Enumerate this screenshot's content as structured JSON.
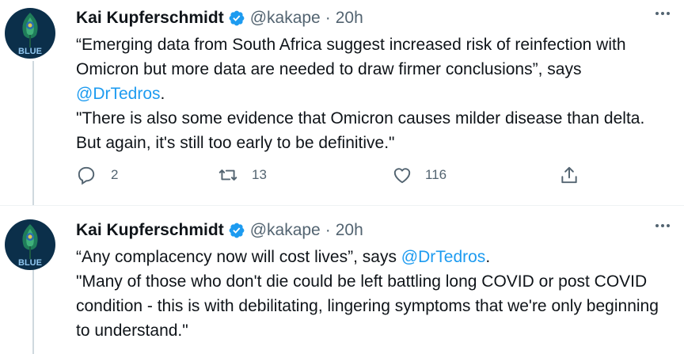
{
  "tweets": [
    {
      "name": "Kai Kupferschmidt",
      "handle": "@kakape",
      "separator": "·",
      "time": "20h",
      "avatar_text": "BLUE",
      "quote_part1": "“Emerging data from South Africa suggest increased risk of reinfection with Omicron but more data are needed to draw firmer conclusions”, says ",
      "mention": "@DrTedros",
      "quote_end": ".",
      "paragraph2": "\"There is also some evidence that Omicron causes milder disease than delta. But again, it's still too early to be definitive.\"",
      "replies": "2",
      "retweets": "13",
      "likes": "116"
    },
    {
      "name": "Kai Kupferschmidt",
      "handle": "@kakape",
      "separator": "·",
      "time": "20h",
      "avatar_text": "BLUE",
      "quote_part1": "“Any complacency now will cost lives”, says ",
      "mention": "@DrTedros",
      "quote_end": ".",
      "paragraph2": "\"Many of those who don't die could be left battling long COVID or post COVID condition - this is with debilitating, lingering symptoms that we're only beginning to understand.\""
    }
  ],
  "colors": {
    "accent": "#1d9bf0",
    "secondary_text": "#536471",
    "thread_line": "#cfd9de"
  },
  "icons": [
    "verified-badge-icon",
    "more-icon",
    "reply-icon",
    "retweet-icon",
    "like-icon",
    "share-icon"
  ]
}
